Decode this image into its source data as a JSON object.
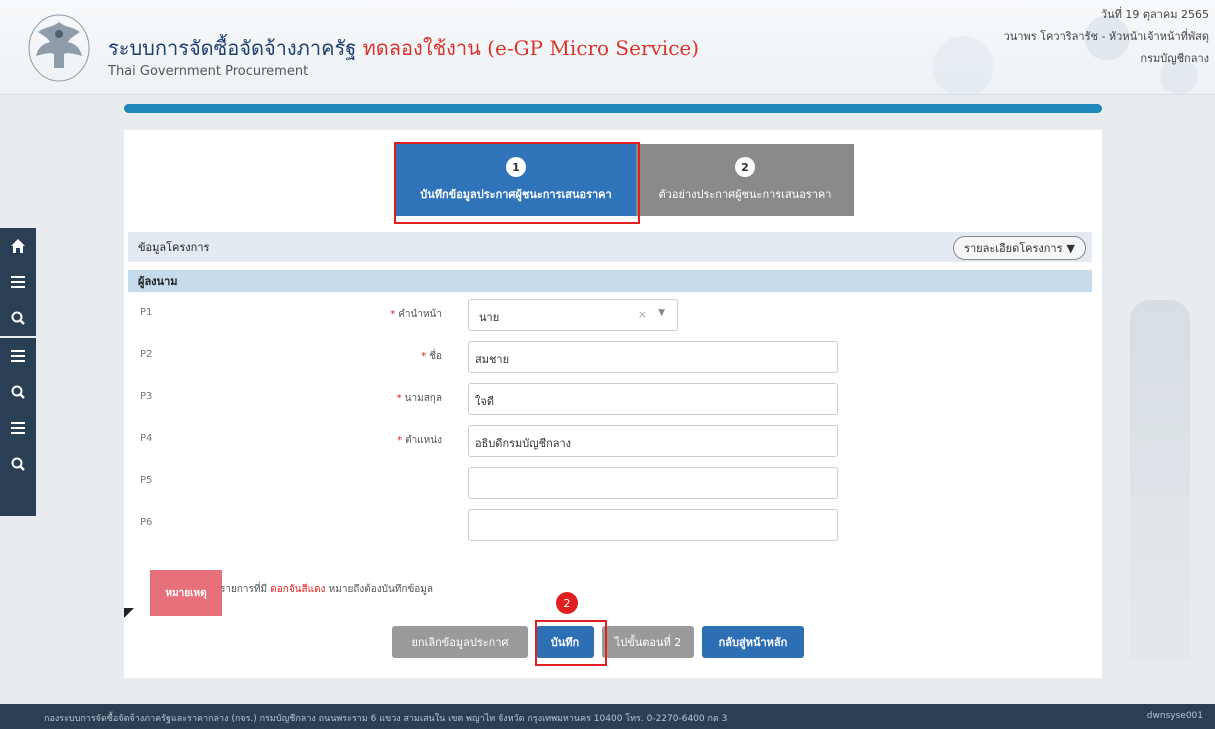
{
  "header": {
    "title_main": "ระบบการจัดซื้อจัดจ้างภาครัฐ",
    "title_test": "ทดลองใช้งาน (e-GP Micro Service)",
    "subtitle": "Thai Government Procurement",
    "date": "วันที่ 19 ตุลาคม 2565",
    "user": "วนาพร โควาริลารัช - หัวหน้าเจ้าหน้าที่พัสดุ",
    "department": "กรมบัญชีกลาง"
  },
  "steps": [
    {
      "num": "1",
      "label": "บันทึกข้อมูลประกาศผู้ชนะการเสนอราคา"
    },
    {
      "num": "2",
      "label": "ตัวอย่างประกาศผู้ชนะการเสนอราคา"
    }
  ],
  "section_project": {
    "label": "ข้อมูลโครงการ",
    "detail_button": "รายละเอียดโครงการ"
  },
  "section_signer": {
    "label": "ผู้ลงนาม"
  },
  "rows": [
    {
      "key": "P1",
      "label": "คำนำหน้า",
      "value": "นาย"
    },
    {
      "key": "P2",
      "label": "ชื่อ",
      "value": "สมชาย"
    },
    {
      "key": "P3",
      "label": "นามสกุล",
      "value": "ใจดี"
    },
    {
      "key": "P4",
      "label": "ตำแหน่ง",
      "value": "อธิบดีกรมบัญชีกลาง"
    },
    {
      "key": "P5",
      "label": "",
      "value": ""
    },
    {
      "key": "P6",
      "label": "",
      "value": ""
    }
  ],
  "note": {
    "tag": "หมายเหตุ",
    "text_before": "รายการที่มี",
    "text_red": "ดอกจันสีแดง",
    "text_after": "หมายถึงต้องบันทึกข้อมูล"
  },
  "buttons": {
    "cancel": "ยกเลิกข้อมูลประกาศ",
    "save": "บันทึก",
    "next": "ไปขั้นตอนที่ 2",
    "back": "กลับสู่หน้าหลัก"
  },
  "callout_number": "2",
  "footer": {
    "left": "กองระบบการจัดซื้อจัดจ้างภาครัฐและราคากลาง (กจร.) กรมบัญชีกลาง ถนนพระราม 6 แขวง สามเสนใน เขต พญาไท จังหวัด กรุงเทพมหานคร 10400 โทร. 0-2270-6400 กด 3",
    "right": "dwnsyse001"
  },
  "colors": {
    "active_step": "#2f73b8",
    "inactive_step": "#8a8a8a",
    "highlight": "#e02020",
    "sidebar": "#2a3f54",
    "required": "#e02020"
  }
}
